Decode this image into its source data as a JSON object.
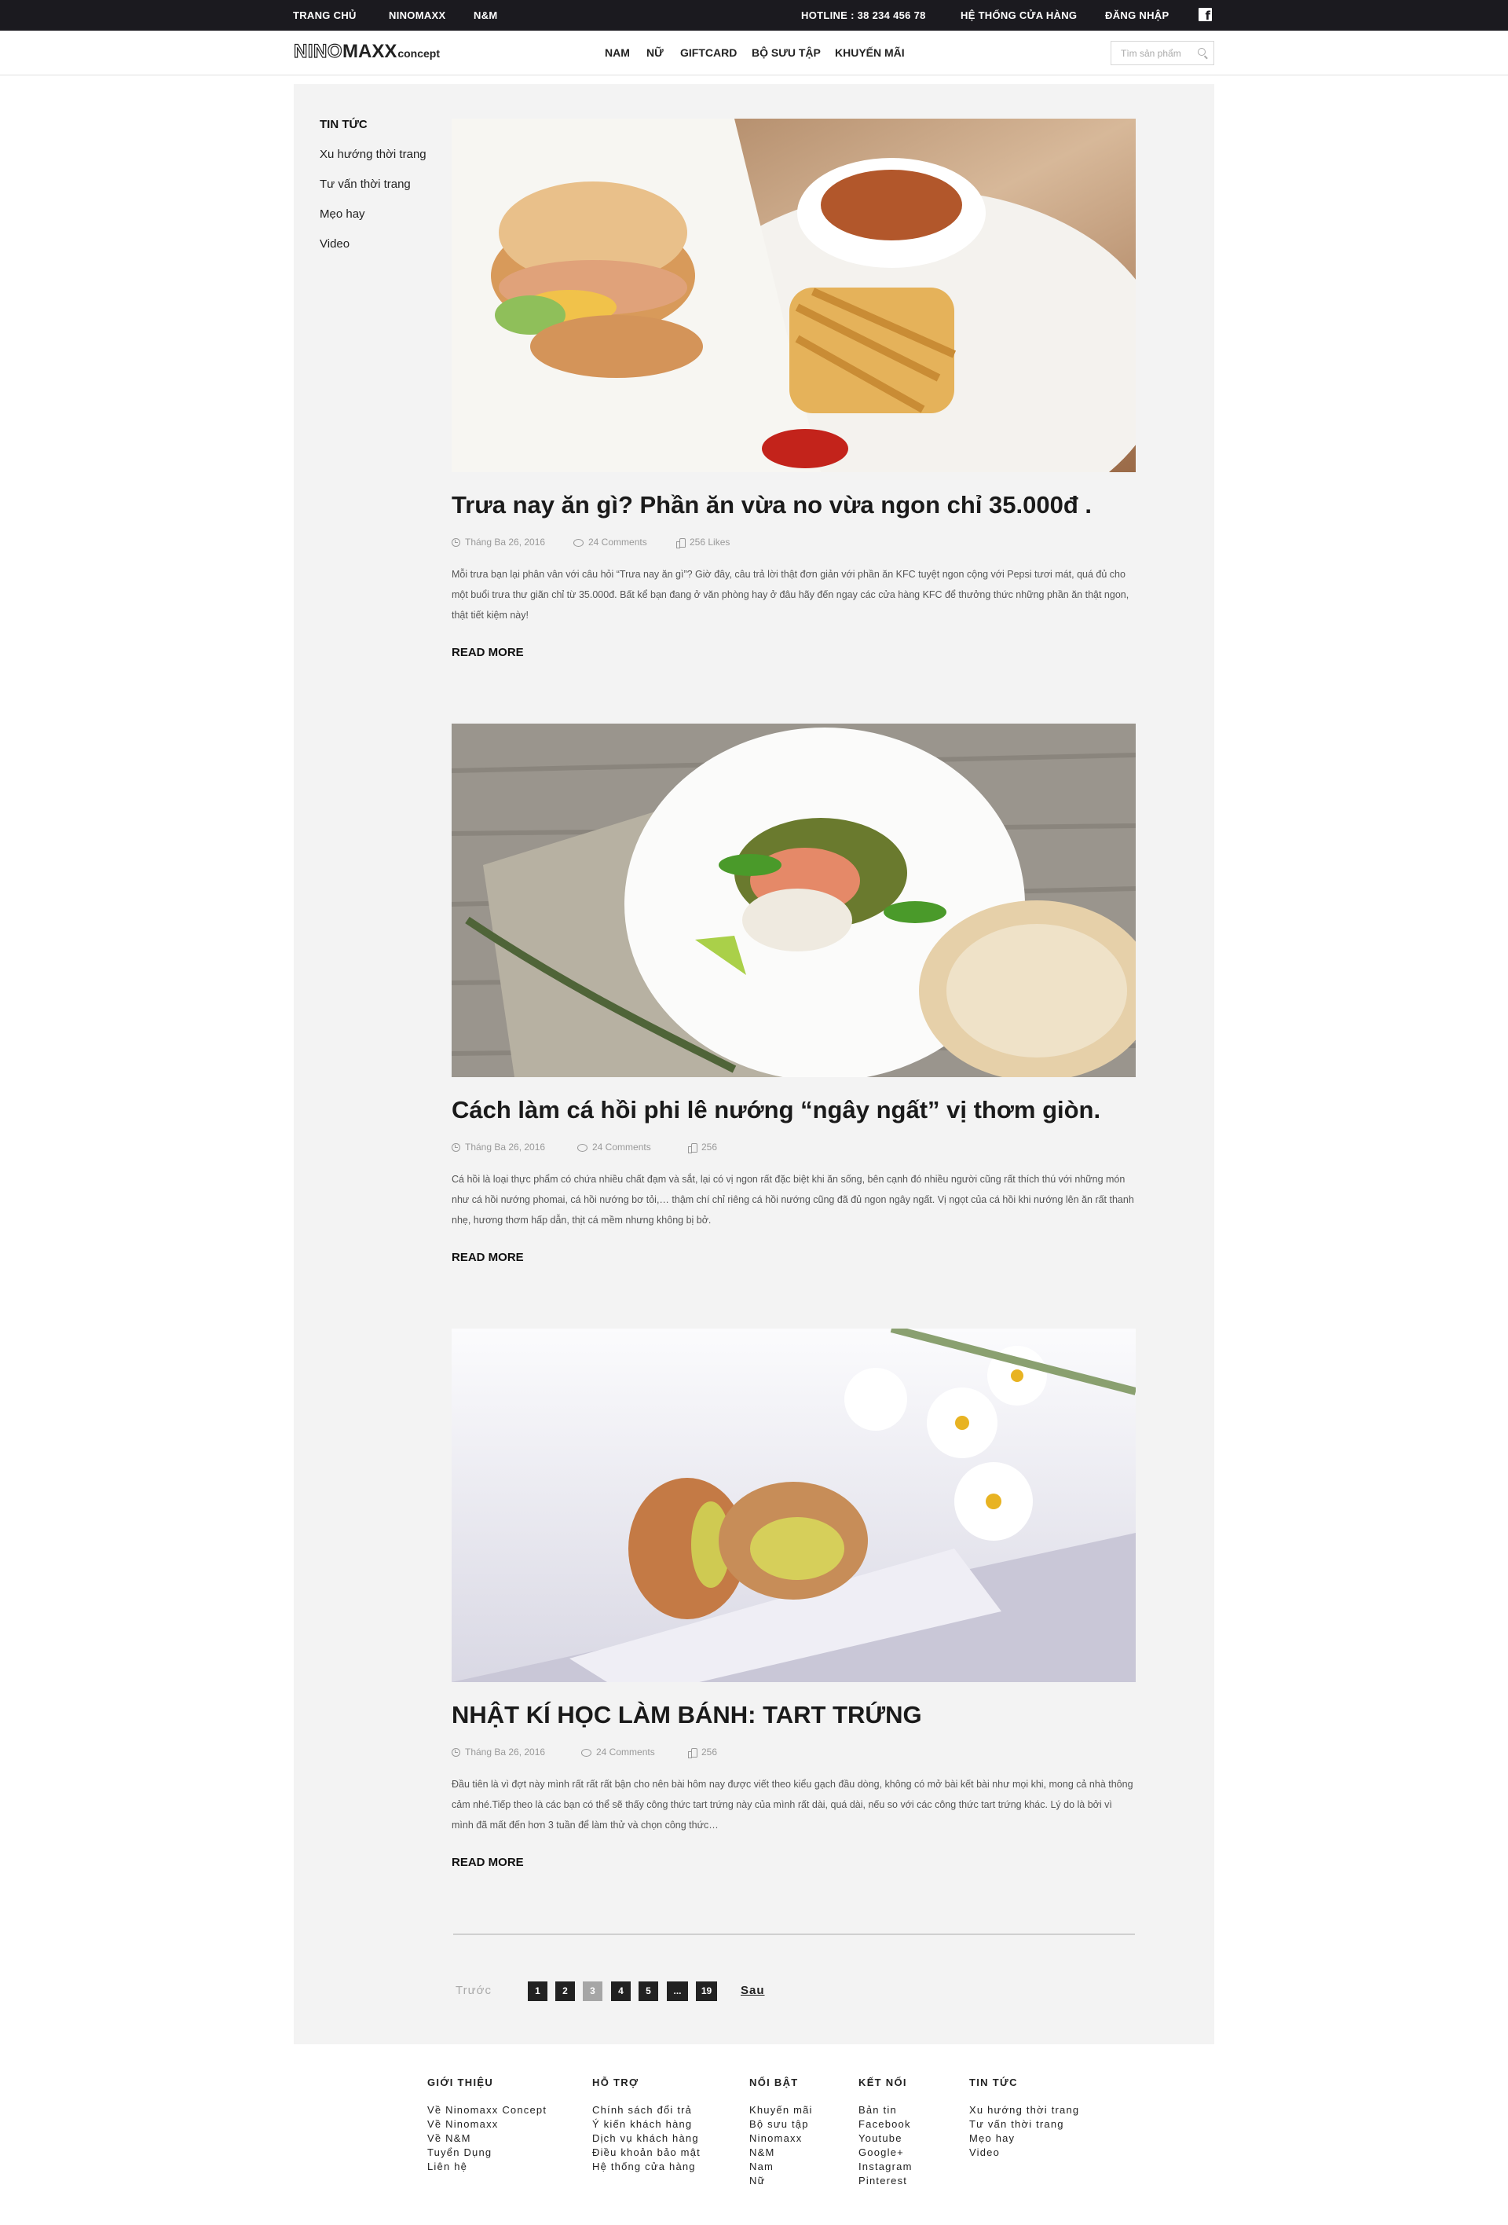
{
  "topbar": {
    "left_links": [
      "TRANG CHỦ",
      "NINOMAXX",
      "N&M"
    ],
    "hotline": "HOTLINE : 38 234 456 78",
    "stores": "HỆ THỐNG CỬA HÀNG",
    "login": "ĐĂNG NHẬP",
    "social_icon": "facebook-icon"
  },
  "header": {
    "logo": {
      "part1": "NINO",
      "part2": "MAXX",
      "part3": "concept"
    },
    "nav": [
      "NAM",
      "NỮ",
      "GIFTCARD",
      "BỘ SƯU TẬP",
      "KHUYẾN MÃI"
    ],
    "search_placeholder": "Tìm sản phẩm"
  },
  "sidebar": {
    "title": "TIN TỨC",
    "items": [
      "Xu hướng thời trang",
      "Tư vấn thời trang",
      "Mẹo hay",
      "Video"
    ]
  },
  "posts": [
    {
      "title": "Trưa nay ăn gì? Phần ăn vừa no vừa ngon chỉ 35.000đ .",
      "date": "Tháng Ba 26, 2016",
      "comments": "24 Comments",
      "likes": "256 Likes",
      "excerpt": "Mỗi trưa bạn lại phân vân với câu hỏi “Trưa nay ăn gì”? Giờ đây, câu trả lời thật đơn giản với phần ăn KFC tuyệt ngon cộng với Pepsi tươi mát, quá đủ cho một buổi trưa thư giãn chỉ từ 35.000đ. Bất kể bạn đang ở văn phòng hay ở đâu hãy đến ngay các cửa hàng KFC để thưởng thức những phần ăn thật ngon, thật tiết kiệm này!",
      "read_more": "READ MORE"
    },
    {
      "title": "Cách làm cá hồi phi lê nướng “ngây ngất” vị thơm giòn.",
      "date": "Tháng Ba 26, 2016",
      "comments": "24 Comments",
      "likes": "256",
      "excerpt": "Cá hồi  là loại thực phẩm có chứa nhiều chất đạm và sắt, lại có vị ngon rất đặc biệt khi ăn sống, bên cạnh đó nhiều người cũng rất thích thú với những món như  cá hồi nướng phomai, cá hồi nướng bơ tỏi,… thậm chí chỉ riêng cá hồi nướng cũng đã đủ ngon ngây ngất. Vị ngọt của cá hồi khi nướng lên ăn rất thanh nhẹ, hương thơm hấp dẫn, thịt cá mềm nhưng không bị bở.",
      "read_more": "READ MORE"
    },
    {
      "title": "NHẬT KÍ HỌC LÀM BÁNH: TART TRỨNG",
      "date": "Tháng Ba 26, 2016",
      "comments": "24 Comments",
      "likes": "256",
      "excerpt": "Đầu tiên là vì đợt này mình rất rất rất bận cho nên bài hôm nay được viết theo kiểu gạch đầu dòng, không có mở bài kết bài như mọi khi, mong cả nhà thông cảm nhé.Tiếp theo là các bạn có thể sẽ thấy công thức tart trứng này của mình rất dài, quá dài, nếu so với các công thức tart trứng khác. Lý do là bởi vì mình đã mất đến hơn 3 tuần để làm thử và chọn công thức…",
      "read_more": "READ MORE"
    }
  ],
  "pagination": {
    "prev": "Trước",
    "pages": [
      "1",
      "2",
      "3",
      "4",
      "5",
      "...",
      "19"
    ],
    "active": "3",
    "next": "Sau"
  },
  "footer": {
    "columns": [
      {
        "title": "GIỚI THIỆU",
        "links": [
          "Về Ninomaxx Concept",
          "Về Ninomaxx",
          "Về N&M",
          "Tuyển Dụng",
          "Liên hệ"
        ]
      },
      {
        "title": "HỖ TRỢ",
        "links": [
          "Chính sách đổi trả",
          "Ý kiến khách hàng",
          "Dịch vụ khách hàng",
          "Điều khoản bảo mật",
          "Hệ thống cửa hàng"
        ]
      },
      {
        "title": "NỔI BẬT",
        "links": [
          "Khuyến mãi",
          "Bộ sưu tập",
          "Ninomaxx",
          "N&M",
          "Nam",
          "Nữ"
        ]
      },
      {
        "title": "KẾT NỐI",
        "links": [
          "Bản tin",
          "Facebook",
          "Youtube",
          "Google+",
          "Instagram",
          "Pinterest"
        ]
      },
      {
        "title": "TIN TỨC",
        "links": [
          "Xu hướng thời trang",
          "Tư vấn thời trang",
          "Mẹo hay",
          "Video"
        ]
      }
    ]
  }
}
